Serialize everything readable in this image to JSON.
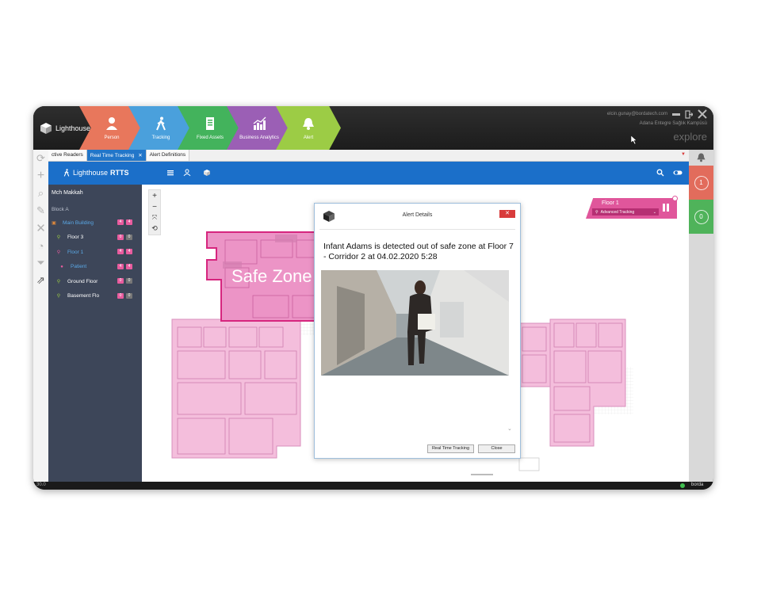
{
  "ribbon": {
    "logo_text": "Lighthouse",
    "modules": [
      {
        "label": "Person",
        "color": "#e8775c",
        "icon": "person-icon"
      },
      {
        "label": "Tracking",
        "color": "#4aa0dc",
        "icon": "walking-icon"
      },
      {
        "label": "Fixed Assets",
        "color": "#43b35c",
        "icon": "document-icon"
      },
      {
        "label": "Business Analytics",
        "color": "#9b5fb5",
        "icon": "chart-icon"
      },
      {
        "label": "Alert",
        "color": "#9ccc45",
        "icon": "bell-icon"
      }
    ],
    "user_email": "elcin.gunay@bordatech.com",
    "org_name": "Adana Entegre Sağlık Kampüsü",
    "explore_label": "explore"
  },
  "tabs": [
    {
      "label": "ctive Readers"
    },
    {
      "label": "Real Time Tracking"
    },
    {
      "label": "Alert Definitions"
    }
  ],
  "header": {
    "app_name_light": "Lighthouse",
    "app_name_bold": "RTTS"
  },
  "sidebar": {
    "hospital": "Mch Makkah",
    "block": "Block A",
    "items": [
      {
        "label": "Main Building",
        "color": "#5aa8e6",
        "pin_color": "#e08a3c",
        "b1": "4",
        "b2": "4",
        "b1_color": "#e85c9e",
        "b2_color": "#e85c9e"
      },
      {
        "label": "Floor 3",
        "color": "#ffffff",
        "pin_color": "#9ccc45",
        "b1": "0",
        "b2": "0",
        "b1_color": "#e85c9e",
        "b2_color": "#777777"
      },
      {
        "label": "Floor 1",
        "color": "#5aa8e6",
        "pin_color": "#e85c9e",
        "b1": "4",
        "b2": "4",
        "b1_color": "#e85c9e",
        "b2_color": "#e85c9e"
      },
      {
        "label": "Patient",
        "color": "#5aa8e6",
        "pin_color": "#e85c9e",
        "b1": "4",
        "b2": "4",
        "b1_color": "#e85c9e",
        "b2_color": "#e85c9e"
      },
      {
        "label": "Ground Floor",
        "color": "#ffffff",
        "pin_color": "#9ccc45",
        "b1": "0",
        "b2": "0",
        "b1_color": "#e85c9e",
        "b2_color": "#777777"
      },
      {
        "label": "Basement Flo",
        "color": "#ffffff",
        "pin_color": "#9ccc45",
        "b1": "0",
        "b2": "0",
        "b1_color": "#e85c9e",
        "b2_color": "#777777"
      }
    ]
  },
  "map": {
    "safe_zone_label": "Safe Zone",
    "floor_widget": {
      "title": "Floor 1",
      "subtitle": "Advanced Tracking"
    }
  },
  "right_strip": {
    "alarm_count": "1",
    "ok_count": "0"
  },
  "dialog": {
    "title": "Alert Details",
    "close_x": "✕",
    "message": "Infant Adams is detected out of safe zone at Floor 7 - Corridor 2 at 04.02.2020 5:28",
    "button_tracking": "Real Time Tracking",
    "button_close": "Close"
  },
  "footer": {
    "version": "30.0",
    "brand": "borda"
  },
  "colors": {
    "accent_blue": "#1b6fc9",
    "zone_pink": "#f2b6d8",
    "zone_border": "#d6257e",
    "alarm_red": "#e26c5c",
    "ok_green": "#4fb35a"
  }
}
